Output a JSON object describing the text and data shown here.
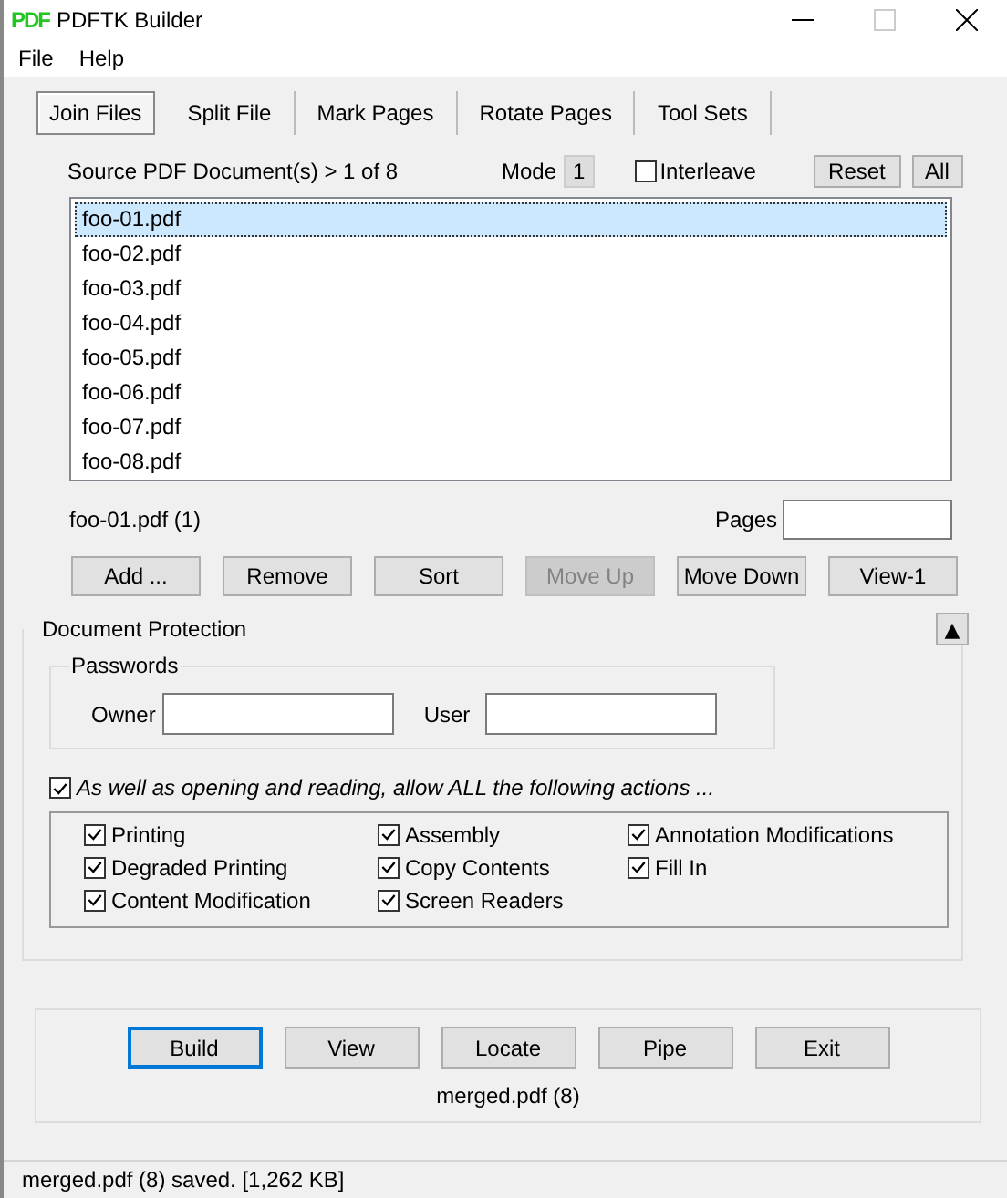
{
  "window": {
    "logo": "PDF",
    "title": "PDFTK Builder"
  },
  "menu": [
    "File",
    "Help"
  ],
  "tabs": [
    {
      "label": "Join Files",
      "selected": true
    },
    {
      "label": "Split File",
      "selected": false
    },
    {
      "label": "Mark Pages",
      "selected": false
    },
    {
      "label": "Rotate Pages",
      "selected": false
    },
    {
      "label": "Tool Sets",
      "selected": false
    }
  ],
  "source": {
    "label": "Source PDF Document(s) > 1 of 8",
    "mode_label": "Mode",
    "mode": "1",
    "interleave": {
      "label": "Interleave",
      "checked": false
    },
    "buttons": [
      "Reset",
      "All"
    ]
  },
  "files": [
    {
      "name": "foo-01.pdf",
      "selected": true
    },
    {
      "name": "foo-02.pdf",
      "selected": false
    },
    {
      "name": "foo-03.pdf",
      "selected": false
    },
    {
      "name": "foo-04.pdf",
      "selected": false
    },
    {
      "name": "foo-05.pdf",
      "selected": false
    },
    {
      "name": "foo-06.pdf",
      "selected": false
    },
    {
      "name": "foo-07.pdf",
      "selected": false
    },
    {
      "name": "foo-08.pdf",
      "selected": false
    }
  ],
  "current": "foo-01.pdf  (1)",
  "pages_label": "Pages",
  "file_buttons": [
    {
      "label": "Add ...",
      "disabled": false
    },
    {
      "label": "Remove",
      "disabled": false
    },
    {
      "label": "Sort",
      "disabled": false
    },
    {
      "label": "Move Up",
      "disabled": true
    },
    {
      "label": "Move Down",
      "disabled": false
    },
    {
      "label": "View-1",
      "disabled": false
    }
  ],
  "protection": {
    "title": "Document Protection",
    "collapse": "▲",
    "passwords_title": "Passwords",
    "owner_label": "Owner",
    "user_label": "User",
    "allow": {
      "label": "As well as opening and reading, allow ALL the following actions ...",
      "checked": true
    },
    "permissions": [
      [
        {
          "label": "Printing",
          "checked": true
        },
        {
          "label": "Degraded Printing",
          "checked": true
        },
        {
          "label": "Content Modification",
          "checked": true
        }
      ],
      [
        {
          "label": "Assembly",
          "checked": true
        },
        {
          "label": "Copy Contents",
          "checked": true
        },
        {
          "label": "Screen Readers",
          "checked": true
        }
      ],
      [
        {
          "label": "Annotation Modifications",
          "checked": true
        },
        {
          "label": "Fill In",
          "checked": true
        }
      ]
    ]
  },
  "actions": [
    {
      "label": "Build",
      "focused": true
    },
    {
      "label": "View",
      "focused": false
    },
    {
      "label": "Locate",
      "focused": false
    },
    {
      "label": "Pipe",
      "focused": false
    },
    {
      "label": "Exit",
      "focused": false
    }
  ],
  "output": "merged.pdf (8)",
  "status_bar": "merged.pdf (8) saved. [1,262 KB]"
}
